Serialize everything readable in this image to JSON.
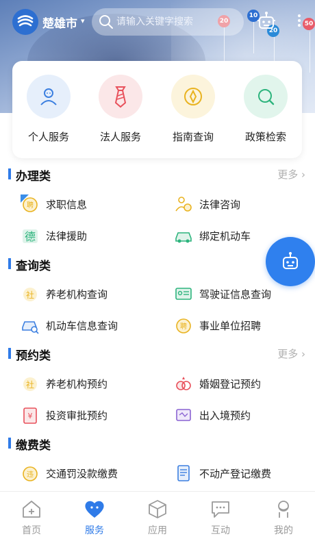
{
  "header": {
    "city": "楚雄市",
    "search_placeholder": "请输入关键字搜索",
    "map_pins": [
      "20",
      "10",
      "20",
      "50"
    ]
  },
  "services": [
    {
      "label": "个人服务",
      "icon": "person-icon",
      "color": "#3b7fe0",
      "bg": "#e6effb"
    },
    {
      "label": "法人服务",
      "icon": "tie-icon",
      "color": "#e8505b",
      "bg": "#fbe7e8"
    },
    {
      "label": "指南查询",
      "icon": "compass-icon",
      "color": "#e9b321",
      "bg": "#fcf4dc"
    },
    {
      "label": "政策检索",
      "icon": "search-icon",
      "color": "#2db47d",
      "bg": "#e1f5ec"
    }
  ],
  "sections": [
    {
      "title": "办理类",
      "more": "更多",
      "items": [
        {
          "label": "求职信息",
          "icon": "hire-icon"
        },
        {
          "label": "法律咨询",
          "icon": "law-consult-icon"
        },
        {
          "label": "法律援助",
          "icon": "law-aid-icon"
        },
        {
          "label": "绑定机动车",
          "icon": "car-bind-icon"
        }
      ]
    },
    {
      "title": "查询类",
      "more": "",
      "items": [
        {
          "label": "养老机构查询",
          "icon": "elder-care-icon"
        },
        {
          "label": "驾驶证信息查询",
          "icon": "license-icon"
        },
        {
          "label": "机动车信息查询",
          "icon": "car-search-icon"
        },
        {
          "label": "事业单位招聘",
          "icon": "hire-icon"
        }
      ]
    },
    {
      "title": "预约类",
      "more": "更多",
      "items": [
        {
          "label": "养老机构预约",
          "icon": "elder-care-icon"
        },
        {
          "label": "婚姻登记预约",
          "icon": "rings-icon"
        },
        {
          "label": "投资审批预约",
          "icon": "invest-icon"
        },
        {
          "label": "出入境预约",
          "icon": "passport-icon"
        }
      ]
    },
    {
      "title": "缴费类",
      "more": "",
      "items": [
        {
          "label": "交通罚没款缴费",
          "icon": "traffic-fine-icon"
        },
        {
          "label": "不动产登记缴费",
          "icon": "property-icon"
        }
      ]
    }
  ],
  "tabbar": [
    {
      "label": "首页",
      "icon": "home-icon",
      "active": false
    },
    {
      "label": "服务",
      "icon": "service-heart-icon",
      "active": true
    },
    {
      "label": "应用",
      "icon": "cube-icon",
      "active": false
    },
    {
      "label": "互动",
      "icon": "chat-icon",
      "active": false
    },
    {
      "label": "我的",
      "icon": "profile-icon",
      "active": false
    }
  ],
  "colors": {
    "accent": "#2f7be8",
    "icon_yellow": "#e9b321",
    "icon_green": "#2db47d"
  }
}
